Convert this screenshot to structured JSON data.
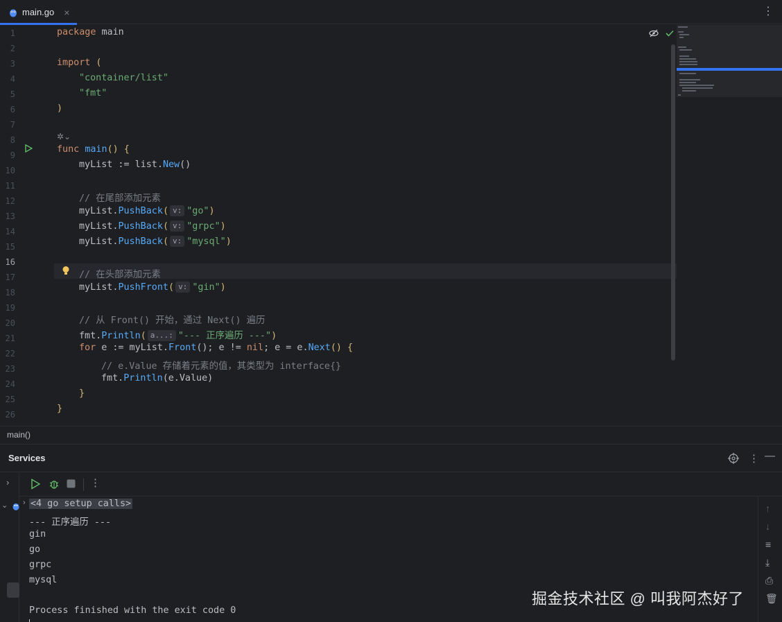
{
  "tab": {
    "filename": "main.go",
    "close": "×",
    "more": "⋮"
  },
  "editor": {
    "current_line": 16,
    "line_numbers": [
      "1",
      "2",
      "3",
      "4",
      "5",
      "6",
      "7",
      "8",
      "9",
      "10",
      "11",
      "12",
      "13",
      "14",
      "15",
      "16",
      "17",
      "18",
      "19",
      "20",
      "21",
      "22",
      "23",
      "24",
      "25",
      "26"
    ],
    "code": {
      "l1_kw": "package",
      "l1_rest": " main",
      "l3_kw": "import",
      "l3_rest": " (",
      "l4": "\"container/list\"",
      "l5": "\"fmt\"",
      "l6": ")",
      "l8_kw": "func",
      "l8_fn": "main",
      "l8_rest": "() {",
      "l9_a": "myList := list.",
      "l9_call": "New",
      "l9_b": "()",
      "l11": "// 在尾部添加元素",
      "pushback": "PushBack",
      "pushfront": "PushFront",
      "mylist": "myList.",
      "hint_v": "v:",
      "l12_str": "\"go\"",
      "l13_str": "\"grpc\"",
      "l14_str": "\"mysql\"",
      "l16": "// 在头部添加元素",
      "l17_str": "\"gin\"",
      "l19": "// 从 Front() 开始，通过 Next() 遍历",
      "l20_a": "fmt.",
      "l20_call": "Println",
      "hint_a": "a...:",
      "l20_str": "\"--- 正序遍历 ---\"",
      "l21_kw": "for",
      "l21_a": " e := myList.",
      "l21_front": "Front",
      "l21_b": "(); e != ",
      "l21_nil": "nil",
      "l21_c": "; e = e.",
      "l21_next": "Next",
      "l21_d": "() {",
      "l22": "// e.Value 存储着元素的值，其类型为 interface{}",
      "l23_a": "fmt.",
      "l23_call": "Println",
      "l23_b": "(e.Value)",
      "l24": "}",
      "l25": "}"
    }
  },
  "breadcrumb": "main()",
  "services": {
    "title": "Services",
    "setup_calls": "<4 go setup calls>",
    "output": [
      "--- 正序遍历 ---",
      "gin",
      "go",
      "grpc",
      "mysql",
      "",
      "Process finished with the exit code 0"
    ],
    "watermark": "掘金技术社区 @ 叫我阿杰好了"
  },
  "colors": {
    "accent": "#3574f0",
    "keyword": "#cf8e6d",
    "string": "#6aab73",
    "function": "#56a8f5",
    "comment": "#7a7e85",
    "background": "#1e1f22"
  }
}
